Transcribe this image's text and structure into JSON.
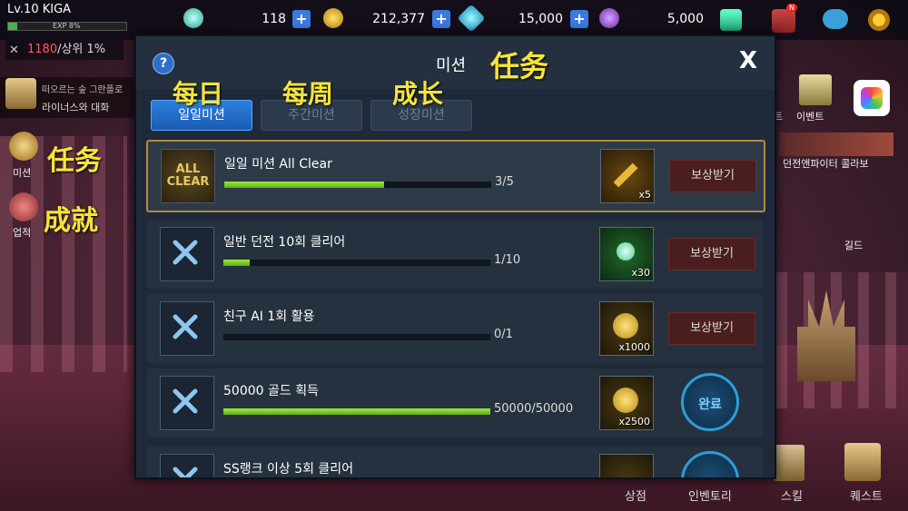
{
  "top": {
    "level": "Lv.10",
    "name": "KIGA",
    "exp": "EXP 8%",
    "exp_fraction": 0.08,
    "stamina": "118",
    "gold": "212,377",
    "gems": "15,000",
    "purple": "5,000",
    "mail_badge": "N",
    "rank_value": "1180",
    "rank_text": "/상위 1%"
  },
  "left": {
    "banner_top": "떠오르는 숲 그란플로",
    "banner_bottom": "라이너스와 대화",
    "mission_label": "미션",
    "achievement_label": "업적"
  },
  "annotations": {
    "tab_daily": "每日",
    "tab_weekly": "每周",
    "tab_growth": "成长",
    "title": "任务",
    "side_mission": "任务",
    "side_achievement": "成就"
  },
  "right": {
    "event_left": "트",
    "event_label": "이벤트",
    "collab": "던전앤파이터 콜라보",
    "guild": "길드"
  },
  "bottom": {
    "shop": "상점",
    "inventory": "인벤토리",
    "skill": "스킬",
    "quest": "퀘스트"
  },
  "dialog": {
    "help": "?",
    "title": "미션",
    "close": "X",
    "tabs": [
      "일일미션",
      "주간미션",
      "성장미션"
    ],
    "rows": [
      {
        "title": "일일 미션 All Clear",
        "count": "3/5",
        "progress": 0.6,
        "reward_qty": "x5",
        "button": "보상받기",
        "icon_text": "ALL CLEAR"
      },
      {
        "title": "일반 던전 10회 클리어",
        "count": "1/10",
        "progress": 0.1,
        "reward_qty": "x30",
        "button": "보상받기"
      },
      {
        "title": "친구 AI 1회 활용",
        "count": "0/1",
        "progress": 0.0,
        "reward_qty": "x1000",
        "button": "보상받기"
      },
      {
        "title": "50000 골드 획득",
        "count": "50000/50000",
        "progress": 1.0,
        "reward_qty": "x2500",
        "button": "완료"
      },
      {
        "title": "SS랭크 이상 5회 클리어"
      }
    ]
  }
}
